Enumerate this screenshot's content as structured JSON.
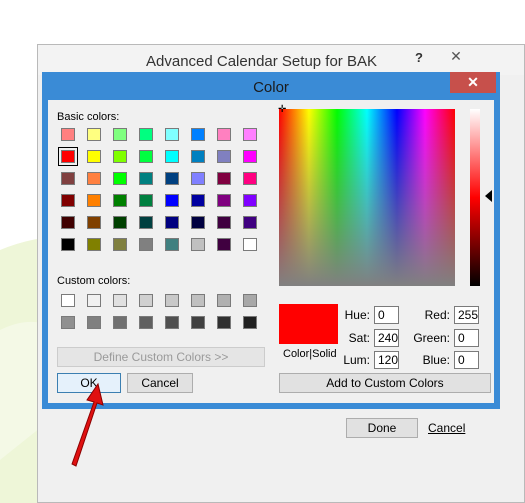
{
  "back_dialog": {
    "title": "Advanced Calendar Setup for BAK",
    "help_label": "?",
    "close_label": "✕",
    "done_label": "Done",
    "cancel_label": "Cancel"
  },
  "color_dialog": {
    "title": "Color",
    "close_label": "✕",
    "basic_colors_label": "Basic colors:",
    "custom_colors_label": "Custom colors:",
    "define_custom_label": "Define Custom Colors >>",
    "ok_label": "OK",
    "cancel_label": "Cancel",
    "add_custom_label": "Add to Custom Colors",
    "color_solid_label": "Color|Solid",
    "hue_label": "Hue:",
    "sat_label": "Sat:",
    "lum_label": "Lum:",
    "red_label": "Red:",
    "green_label": "Green:",
    "blue_label": "Blue:",
    "hue": "0",
    "sat": "240",
    "lum": "120",
    "red": "255",
    "green": "0",
    "blue": "0",
    "selected_color": "#ff0000",
    "basic_colors": [
      [
        "#ff8080",
        "#ffff80",
        "#80ff80",
        "#00ff80",
        "#80ffff",
        "#0080ff",
        "#ff80c0",
        "#ff80ff"
      ],
      [
        "#ff0000",
        "#ffff00",
        "#80ff00",
        "#00ff40",
        "#00ffff",
        "#0080c0",
        "#8080c0",
        "#ff00ff"
      ],
      [
        "#804040",
        "#ff8040",
        "#00ff00",
        "#008080",
        "#004080",
        "#8080ff",
        "#800040",
        "#ff0080"
      ],
      [
        "#800000",
        "#ff8000",
        "#008000",
        "#008040",
        "#0000ff",
        "#0000a0",
        "#800080",
        "#8000ff"
      ],
      [
        "#400000",
        "#804000",
        "#004000",
        "#004040",
        "#000080",
        "#000040",
        "#400040",
        "#400080"
      ],
      [
        "#000000",
        "#808000",
        "#808040",
        "#808080",
        "#408080",
        "#c0c0c0",
        "#400040",
        "#ffffff"
      ]
    ],
    "custom_colors": [
      [
        "#ffffff",
        "#f0f0f0",
        "#e0e0e0",
        "#d0d0d0",
        "#c8c8c8",
        "#c0c0c0",
        "#b0b0b0",
        "#a8a8a8"
      ],
      [
        "#909090",
        "#808080",
        "#707070",
        "#606060",
        "#505050",
        "#404040",
        "#303030",
        "#202020"
      ]
    ]
  }
}
